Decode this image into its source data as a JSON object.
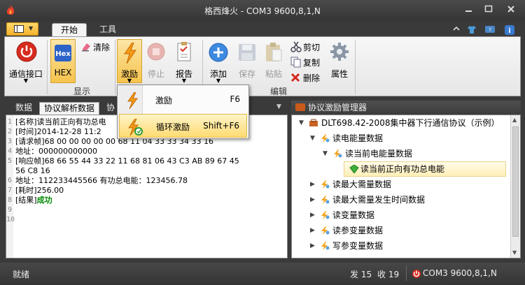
{
  "window": {
    "title": "格西烽火 - COM3  9600,8,1,N"
  },
  "ribbon_tabs": [
    {
      "label": "开始"
    },
    {
      "label": "工具"
    }
  ],
  "ribbon": {
    "connect_label": "通信接口",
    "hex_label": "HEX",
    "hex_icon_text": "Hex",
    "clear_label": "清除",
    "display_group": "显示",
    "stimulate_label": "激励",
    "stop_label": "停止",
    "report_label": "报告",
    "add_label": "添加",
    "save_label": "保存",
    "paste_label": "粘贴",
    "cut_label": "剪切",
    "copy_label": "复制",
    "delete_label": "删除",
    "properties_label": "属性",
    "edit_group": "编辑"
  },
  "left_tabs": [
    {
      "label": "数据"
    },
    {
      "label": "协议解析数据"
    },
    {
      "label": "协"
    }
  ],
  "editor_lines": [
    {
      "num": "1",
      "text": "[名称]读当前正向有功总电"
    },
    {
      "num": "2",
      "text": "[时间]2014-12-28 11:2"
    },
    {
      "num": "3",
      "text": "[请求帧]68 00 00 00 00 00 68 11 04 33 33 34 33 16"
    },
    {
      "num": "4",
      "text": " 地址：000000000000"
    },
    {
      "num": "5",
      "text": "[响应帧]68 66 55 44 33 22 11 68 81 06 43 C3 AB 89 67 45"
    },
    {
      "num": "",
      "text": "56 C8 16"
    },
    {
      "num": "6",
      "text": " 地址：112233445566   有功总电能：123456.78"
    },
    {
      "num": "7",
      "text": "[耗时]256.00"
    },
    {
      "num": "8",
      "text": "[结果]",
      "ok": "成功"
    },
    {
      "num": "9",
      "text": ""
    },
    {
      "num": "10",
      "text": ""
    }
  ],
  "right_panel": {
    "title": "协议激励管理器"
  },
  "tree_nodes": [
    {
      "label": "DLT698.42-2008集中器下行通信协议（示例）",
      "arrow": "▼"
    },
    {
      "label": "读电能量数据",
      "arrow": "▼"
    },
    {
      "label": "读当前电能量数据",
      "arrow": "▼"
    },
    {
      "label": "读当前正向有功总电能",
      "arrow": ""
    },
    {
      "label": "读最大需量数据",
      "arrow": "▶"
    },
    {
      "label": "读最大需量发生时间数据",
      "arrow": "▶"
    },
    {
      "label": "读变量数据",
      "arrow": "▶"
    },
    {
      "label": "读参变量数据",
      "arrow": "▶"
    },
    {
      "label": "写参变量数据",
      "arrow": "▶"
    }
  ],
  "context_menu": {
    "items": [
      {
        "label": "激励",
        "shortcut": "F6"
      },
      {
        "label": "循环激励",
        "shortcut": "Shift+F6"
      }
    ]
  },
  "status": {
    "ready": "就绪",
    "sent": "发 15",
    "received": "收 19",
    "port": "COM3  9600,8,1,N"
  },
  "colors": {
    "accent": "#f4b22c",
    "ok": "#008a00",
    "hilite": "#ffd865",
    "title_bg": "#3a3a3a"
  }
}
